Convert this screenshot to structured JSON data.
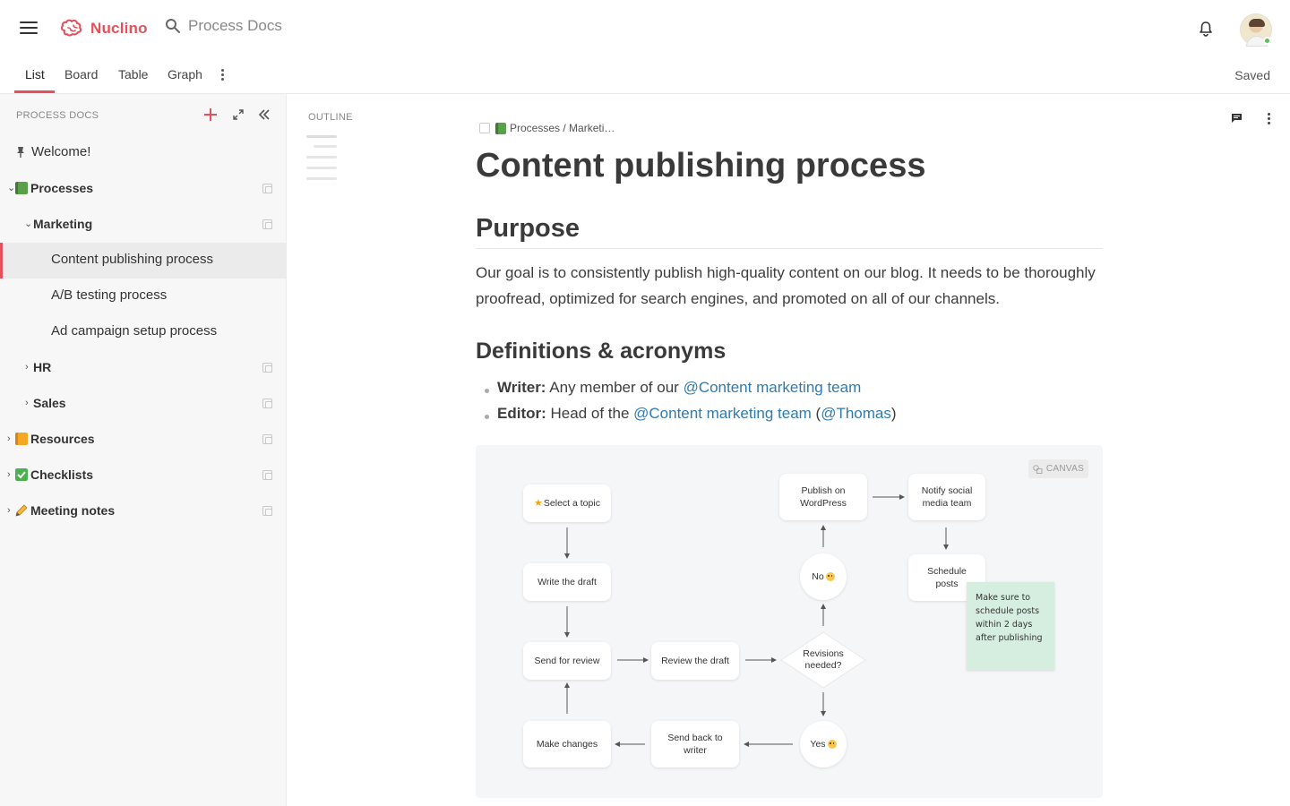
{
  "app": {
    "name": "Nuclino",
    "search_placeholder": "Process Docs"
  },
  "tabs": [
    {
      "label": "List",
      "active": true
    },
    {
      "label": "Board"
    },
    {
      "label": "Table"
    },
    {
      "label": "Graph"
    }
  ],
  "status": "Saved",
  "sidebar": {
    "header": "PROCESS DOCS",
    "items": [
      {
        "label": "Welcome!",
        "icon": "pin-icon",
        "level": 0
      },
      {
        "label": "Processes",
        "icon": "green-book-icon",
        "level": 0,
        "expanded": true
      },
      {
        "label": "Marketing",
        "level": 1,
        "expanded": true
      },
      {
        "label": "Content publishing process",
        "level": 2,
        "active": true
      },
      {
        "label": "A/B testing process",
        "level": 2
      },
      {
        "label": "Ad campaign setup process",
        "level": 2
      },
      {
        "label": "HR",
        "level": 1
      },
      {
        "label": "Sales",
        "level": 1
      },
      {
        "label": "Resources",
        "icon": "orange-book-icon",
        "level": 0
      },
      {
        "label": "Checklists",
        "icon": "check-mark-icon",
        "level": 0
      },
      {
        "label": "Meeting notes",
        "icon": "pencil-icon",
        "level": 0
      }
    ]
  },
  "outline": {
    "title": "OUTLINE"
  },
  "doc": {
    "breadcrumb": "Processes / Marketi…",
    "title": "Content publishing process",
    "purpose_heading": "Purpose",
    "purpose_text": "Our goal is to consistently publish high-quality content on our blog. It needs to be thoroughly proofread, optimized for search engines, and promoted on all of our channels.",
    "defs_heading": "Definitions & acronyms",
    "defs": [
      {
        "term": "Writer:",
        "text": " Any member of our ",
        "mention": "@Content marketing team"
      },
      {
        "term": "Editor:",
        "text": " Head of the ",
        "mention": "@Content marketing team",
        "text2": " (",
        "mention2": "@Thomas",
        "text3": ")"
      }
    ]
  },
  "canvas": {
    "badge": "CANVAS",
    "nodes": {
      "select_topic": "Select a topic",
      "write_draft": "Write the draft",
      "send_review": "Send for review",
      "review_draft": "Review the draft",
      "revisions": "Revisions needed?",
      "no": "No",
      "yes": "Yes",
      "publish": "Publish on WordPress",
      "notify": "Notify social media team",
      "schedule": "Schedule posts",
      "send_back": "Send back to writer",
      "make_changes": "Make changes"
    },
    "sticky_note": "Make sure to schedule posts within 2 days after publishing"
  },
  "colors": {
    "accent": "#e4515c",
    "link": "#2f7bb0",
    "sticky": "#d5eee0"
  }
}
